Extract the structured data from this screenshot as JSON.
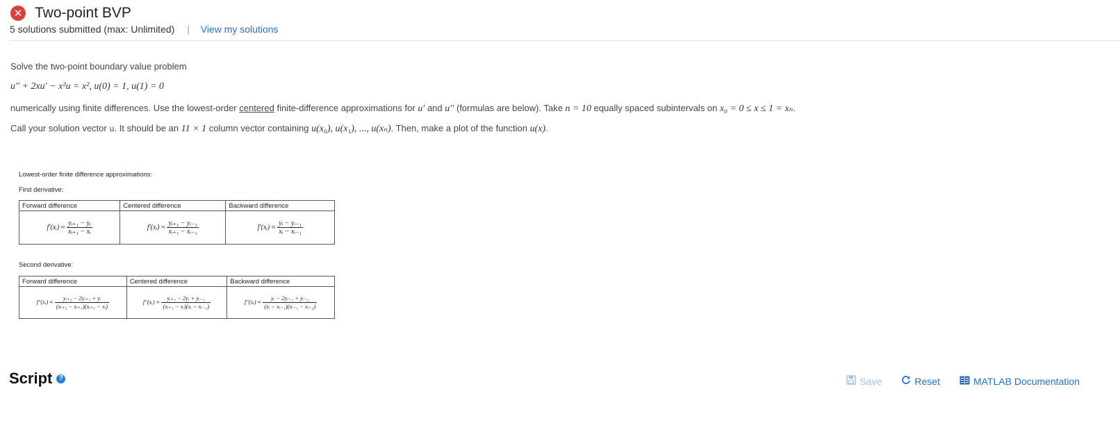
{
  "header": {
    "status_icon": "error-x-icon",
    "title": "Two-point BVP",
    "submissions": "5 solutions submitted (max: Unlimited)",
    "separator": "|",
    "view_link": "View my solutions"
  },
  "problem": {
    "intro": "Solve the two-point boundary value problem",
    "equation": "u'' + 2xu' − x²u = x², u(0) = 1, u(1) = 0",
    "line2_a": "numerically using finite differences. Use the lowest-order ",
    "line2_centered": "centered",
    "line2_b": " finite-difference approximations for ",
    "line2_uprime": "u′",
    "line2_and": " and ",
    "line2_udoubleprime": "u′′",
    "line2_c": " (formulas are below). Take ",
    "line2_n": "n = 10",
    "line2_d": " equally spaced subintervals on ",
    "line2_interval": "x₀ = 0 ≤ x ≤ 1 = xₙ",
    "line2_end": ".",
    "line3_a": "Call your solution vector ",
    "line3_var": "u",
    "line3_b": ". It should be an ",
    "line3_dim": "11 × 1",
    "line3_c": " column vector containing ",
    "line3_entries": "u(x₀), u(x₁), ..., u(xₙ)",
    "line3_d": ". Then, make a plot of the function ",
    "line3_fn": "u(x)",
    "line3_end": "."
  },
  "fd": {
    "heading": "Lowest-order finite difference approximations:",
    "first_label": "First derivative:",
    "second_label": "Second derivative:",
    "columns": [
      "Forward difference",
      "Centered difference",
      "Backward difference"
    ],
    "first": [
      {
        "lhs": "f′(xᵢ) ≈",
        "num": "yᵢ₊₁ − yᵢ",
        "den": "xᵢ₊₁ − xᵢ"
      },
      {
        "lhs": "f′(xᵢ) ≈",
        "num": "yᵢ₊₁ − yᵢ₋₁",
        "den": "xᵢ₊₁ − xᵢ₋₁"
      },
      {
        "lhs": "f′(xᵢ) ≈",
        "num": "yᵢ − yᵢ₋₁",
        "den": "xᵢ − xᵢ₋₁"
      }
    ],
    "second": [
      {
        "lhs": "f″(xᵢ) ≈",
        "num": "yᵢ₊₂ − 2yᵢ₊₁ + yᵢ",
        "den": "(xᵢ₊₂ − xᵢ₊₁)(xᵢ₊₁ − xᵢ)"
      },
      {
        "lhs": "f″(xᵢ) ≈",
        "num": "yᵢ₊₁ − 2yᵢ + yᵢ₋₁",
        "den": "(xᵢ₊₁ − xᵢ)(xᵢ − xᵢ₋₁)"
      },
      {
        "lhs": "f″(xᵢ) ≈",
        "num": "yᵢ − 2yᵢ₋₁ + yᵢ₋₂",
        "den": "(xᵢ − xᵢ₋₁)(xᵢ₋₁ − xᵢ₋₂)"
      }
    ]
  },
  "script": {
    "title": "Script",
    "help_icon": "question-circle-icon"
  },
  "toolbar": {
    "save_label": "Save",
    "save_icon": "floppy-disk-icon",
    "reset_label": "Reset",
    "reset_icon": "refresh-icon",
    "doc_label": "MATLAB Documentation",
    "doc_icon": "book-icon"
  },
  "colors": {
    "error_red": "#d9413c",
    "link_blue": "#2a6ebb",
    "disabled_blue": "#9fc3e6"
  }
}
